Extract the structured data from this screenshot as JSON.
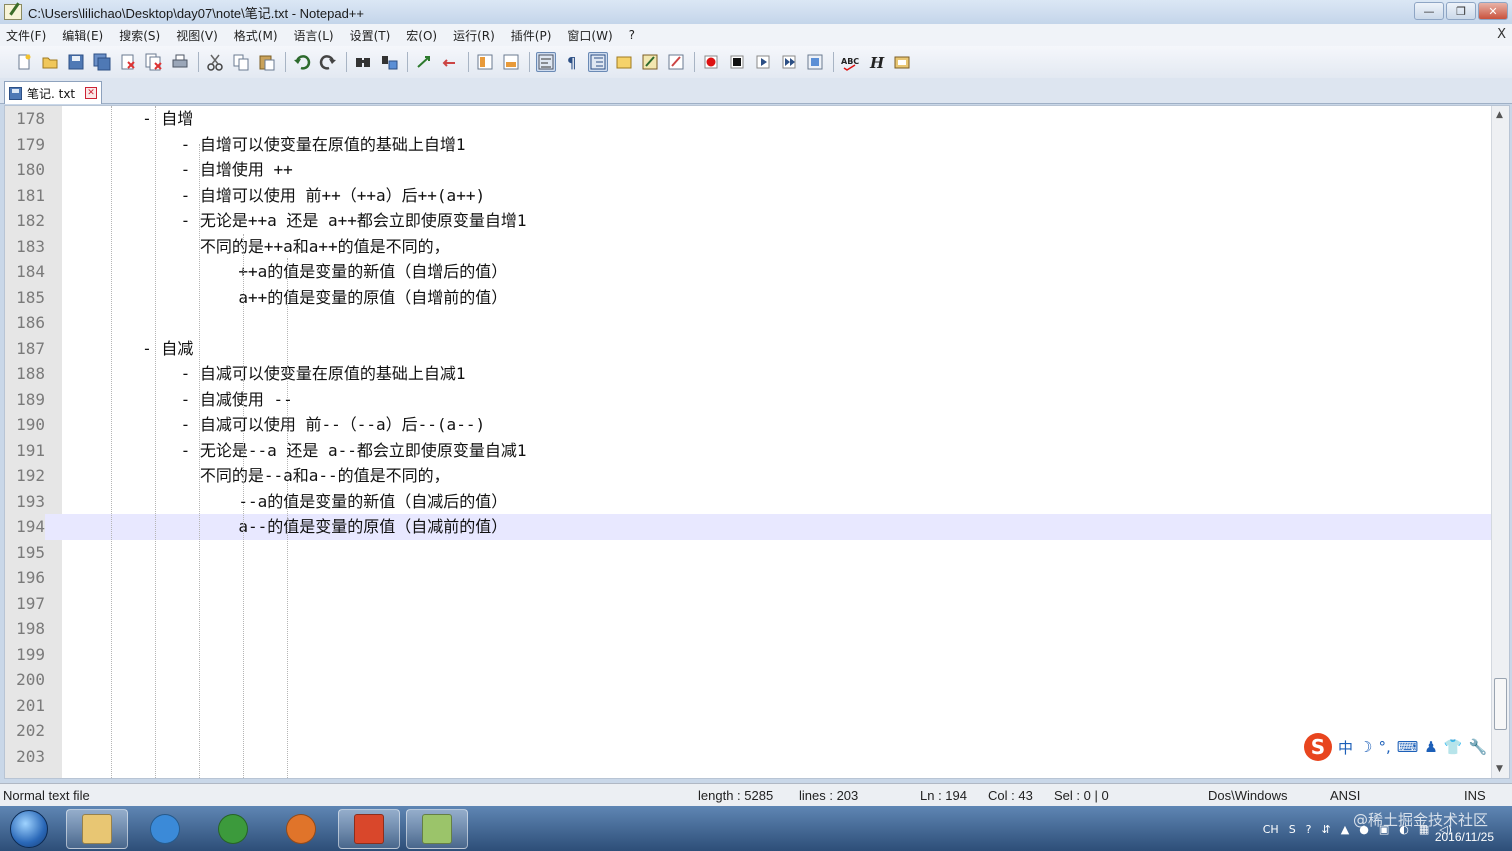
{
  "window": {
    "title": "C:\\Users\\lilichao\\Desktop\\day07\\note\\笔记.txt - Notepad++",
    "controls": {
      "minimize": "—",
      "restore": "❐",
      "close": "✕"
    }
  },
  "menu": {
    "items": [
      "文件(F)",
      "编辑(E)",
      "搜索(S)",
      "视图(V)",
      "格式(M)",
      "语言(L)",
      "设置(T)",
      "宏(O)",
      "运行(R)",
      "插件(P)",
      "窗口(W)",
      "?"
    ],
    "close_label": "X"
  },
  "toolbar": {
    "buttons": [
      "new-file-icon",
      "open-file-icon",
      "save-icon",
      "save-all-icon",
      "close-icon",
      "close-all-icon",
      "print-icon",
      "cut-icon",
      "copy-icon",
      "paste-icon",
      "undo-icon",
      "redo-icon",
      "find-icon",
      "replace-icon",
      "zoom-in-icon",
      "zoom-out-icon",
      "sync-vertical-icon",
      "sync-horizontal-icon",
      "word-wrap-icon",
      "show-all-chars-icon",
      "indent-guide-icon",
      "user-language-icon",
      "function-list-icon",
      "document-map-icon",
      "record-macro-icon",
      "stop-record-icon",
      "play-macro-icon",
      "run-macro-multiple-icon",
      "save-macro-icon",
      "spell-check-icon",
      "html-tag-icon",
      "clipboard-icon"
    ],
    "spellcheck_label": "ABC",
    "html_label": "H"
  },
  "tab": {
    "label": "笔记. txt"
  },
  "editor": {
    "lines": [
      {
        "num": "178",
        "text": "        - 自增"
      },
      {
        "num": "179",
        "text": "            - 自增可以使变量在原值的基础上自增1"
      },
      {
        "num": "180",
        "text": "            - 自增使用 ++"
      },
      {
        "num": "181",
        "text": "            - 自增可以使用 前++（++a）后++(a++)"
      },
      {
        "num": "182",
        "text": "            - 无论是++a 还是 a++都会立即使原变量自增1"
      },
      {
        "num": "183",
        "text": "              不同的是++a和a++的值是不同的，"
      },
      {
        "num": "184",
        "text": "                  ++a的值是变量的新值（自增后的值）"
      },
      {
        "num": "185",
        "text": "                  a++的值是变量的原值（自增前的值）"
      },
      {
        "num": "186",
        "text": ""
      },
      {
        "num": "187",
        "text": "        - 自减"
      },
      {
        "num": "188",
        "text": "            - 自减可以使变量在原值的基础上自减1"
      },
      {
        "num": "189",
        "text": "            - 自减使用 --"
      },
      {
        "num": "190",
        "text": "            - 自减可以使用 前--（--a）后--(a--)"
      },
      {
        "num": "191",
        "text": "            - 无论是--a 还是 a--都会立即使原变量自减1"
      },
      {
        "num": "192",
        "text": "              不同的是--a和a--的值是不同的，"
      },
      {
        "num": "193",
        "text": "                  --a的值是变量的新值（自减后的值）"
      },
      {
        "num": "194",
        "text": "                  a--的值是变量的原值（自减前的值）"
      },
      {
        "num": "195",
        "text": ""
      },
      {
        "num": "196",
        "text": ""
      },
      {
        "num": "197",
        "text": ""
      },
      {
        "num": "198",
        "text": ""
      },
      {
        "num": "199",
        "text": ""
      },
      {
        "num": "200",
        "text": ""
      },
      {
        "num": "201",
        "text": ""
      },
      {
        "num": "202",
        "text": ""
      },
      {
        "num": "203",
        "text": ""
      }
    ],
    "current_line": "194"
  },
  "ime": {
    "logo": "S",
    "items": [
      "中",
      "☽",
      "°,",
      "⌨",
      "♟",
      "👕",
      "🔧"
    ]
  },
  "status": {
    "file_type": "Normal text file",
    "length": "length : 5285",
    "lines": "lines : 203",
    "ln": "Ln : 194",
    "col": "Col : 43",
    "sel": "Sel : 0 | 0",
    "eol": "Dos\\Windows",
    "encoding": "ANSI",
    "mode": "INS"
  },
  "taskbar": {
    "apps": [
      "explorer-icon",
      "ie-icon",
      "chrome-icon",
      "firefox-icon",
      "hbuilder-icon",
      "notepadpp-icon"
    ],
    "tray": [
      "CH",
      "S",
      "?",
      "⇵",
      "▲",
      "●",
      "▣",
      "◐",
      "▦",
      "◁)"
    ],
    "date": "2016/11/25",
    "watermark": "@稀土掘金技术社区"
  },
  "colors": {
    "current_line": "#e8e8ff",
    "gutter": "#e6e6e6",
    "titlebar": "#c4d5ea",
    "taskbar": "#3f638f"
  }
}
